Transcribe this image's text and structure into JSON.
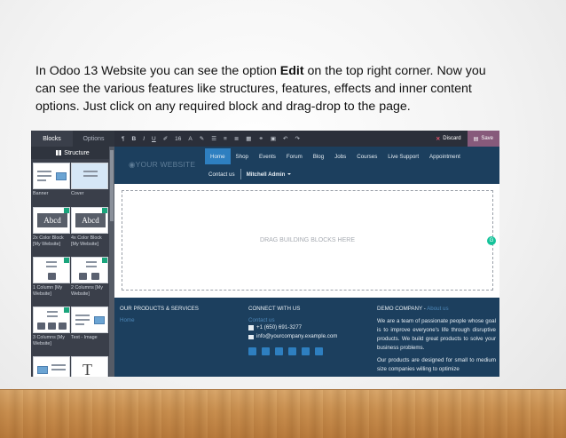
{
  "caption": {
    "part1": "In Odoo 13 Website you can see the option ",
    "bold": "Edit",
    "part2": " on the top right corner. Now you can see the various features like structures, features, effects and inner content options. Just click on any required block and drag-drop to the page."
  },
  "editor": {
    "tabs": [
      "Blocks",
      "Options"
    ],
    "section_title": "Structure",
    "blocks": [
      {
        "label": "Banner"
      },
      {
        "label": "Cover"
      },
      {
        "label": "2x Color Block [My Website]"
      },
      {
        "label": "4x Color Block [My Website]"
      },
      {
        "label": "1 Column [My Website]"
      },
      {
        "label": "2 Columns [My Website]"
      },
      {
        "label": "3 Columns [My Website]"
      },
      {
        "label": "Text - Image"
      }
    ],
    "abcd_text": "Abcd",
    "toolbar": {
      "style": "¶",
      "bold": "B",
      "italic": "I",
      "underline": "U",
      "size": "16",
      "font_color": "A",
      "discard": "Discard",
      "save": "Save"
    }
  },
  "site": {
    "logo": "YOUR WEBSITE",
    "nav": [
      "Home",
      "Shop",
      "Events",
      "Forum",
      "Blog",
      "Jobs",
      "Courses",
      "Live Support",
      "Appointment"
    ],
    "contact": "Contact us",
    "user": "Mitchell Admin",
    "drop_text": "DRAG BUILDING BLOCKS HERE",
    "footer": {
      "col1_title": "OUR PRODUCTS & SERVICES",
      "col1_link": "Home",
      "col2_title": "CONNECT WITH US",
      "col2_link": "Contact us",
      "phone": "+1 (650) 691-3277",
      "email": "info@yourcompany.example.com",
      "col3_title": "DEMO COMPANY - ",
      "col3_about": "About us",
      "para1": "We are a team of passionate people whose goal is to improve everyone's life through disruptive products. We build great products to solve your business problems.",
      "para2": "Our products are designed for small to medium size companies willing to optimize"
    }
  },
  "colors": {
    "site_header": "#1c3f5e",
    "nav_active": "#2e7fc0",
    "save_button": "#875a7b",
    "panel": "#3a3f4a"
  }
}
